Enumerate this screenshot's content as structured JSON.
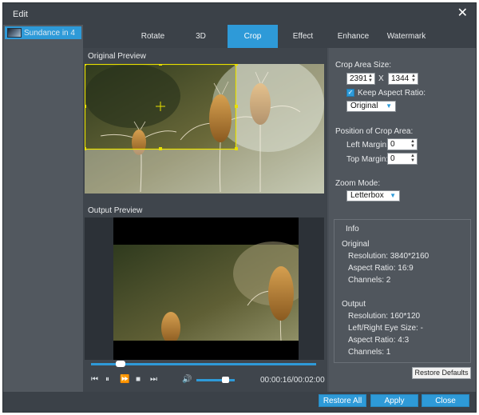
{
  "window": {
    "title": "Edit",
    "close_label": "✕"
  },
  "sidebar": {
    "file_name": "Sundance in 4"
  },
  "tabs": [
    "Rotate",
    "3D",
    "Crop",
    "Effect",
    "Enhance",
    "Watermark"
  ],
  "active_tab": "Crop",
  "preview": {
    "original_label": "Original Preview",
    "output_label": "Output Preview"
  },
  "player": {
    "time": "00:00:16/00:02:00",
    "seek_progress": 0.13,
    "volume": 0.75
  },
  "crop": {
    "area_size_label": "Crop Area Size:",
    "width": "2391",
    "x_sep": "X",
    "height": "1344",
    "keep_aspect_label": "Keep Aspect Ratio:",
    "keep_aspect_checked": true,
    "aspect_value": "Original",
    "position_label": "Position of Crop Area:",
    "left_margin_label": "Left Margin:",
    "left_margin": "0",
    "top_margin_label": "Top Margin:",
    "top_margin": "0",
    "zoom_mode_label": "Zoom Mode:",
    "zoom_mode": "Letterbox"
  },
  "info": {
    "title": "Info",
    "original_heading": "Original",
    "original_resolution": "Resolution: 3840*2160",
    "original_aspect": "Aspect Ratio: 16:9",
    "original_channels": "Channels: 2",
    "output_heading": "Output",
    "output_resolution": "Resolution: 160*120",
    "output_eye_size": "Left/Right Eye Size: -",
    "output_aspect": "Aspect Ratio: 4:3",
    "output_channels": "Channels: 1"
  },
  "buttons": {
    "restore_defaults": "Restore Defaults",
    "restore_all": "Restore All",
    "apply": "Apply",
    "close": "Close"
  },
  "colors": {
    "accent": "#2e9ad8",
    "crop_frame": "#e8e000"
  }
}
